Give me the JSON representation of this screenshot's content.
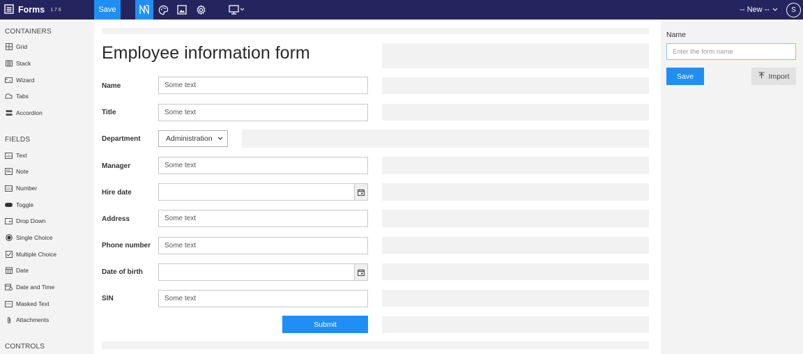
{
  "app": {
    "name": "Forms",
    "version": "1.7.6"
  },
  "toolbar": {
    "save_label": "Save",
    "new_label": "-- New --",
    "avatar_initial": "S"
  },
  "sidebar": {
    "containers_heading": "CONTAINERS",
    "containers": [
      {
        "label": "Grid",
        "icon": "grid-icon"
      },
      {
        "label": "Stack",
        "icon": "stack-icon"
      },
      {
        "label": "Wizard",
        "icon": "wizard-icon"
      },
      {
        "label": "Tabs",
        "icon": "tabs-icon"
      },
      {
        "label": "Accordion",
        "icon": "accordion-icon"
      }
    ],
    "fields_heading": "FIELDS",
    "fields": [
      {
        "label": "Text",
        "icon": "text-field-icon"
      },
      {
        "label": "Note",
        "icon": "note-icon"
      },
      {
        "label": "Number",
        "icon": "number-icon"
      },
      {
        "label": "Toggle",
        "icon": "toggle-icon"
      },
      {
        "label": "Drop Down",
        "icon": "dropdown-icon"
      },
      {
        "label": "Single Choice",
        "icon": "radio-icon"
      },
      {
        "label": "Multiple Choice",
        "icon": "checkbox-icon"
      },
      {
        "label": "Date",
        "icon": "calendar-icon"
      },
      {
        "label": "Date and Time",
        "icon": "datetime-icon"
      },
      {
        "label": "Masked Text",
        "icon": "masked-text-icon"
      },
      {
        "label": "Attachments",
        "icon": "paperclip-icon"
      }
    ],
    "controls_heading": "CONTROLS"
  },
  "form": {
    "title": "Employee information form",
    "fields": [
      {
        "label": "Name",
        "placeholder": "Some text"
      },
      {
        "label": "Title",
        "placeholder": "Some text"
      },
      {
        "label": "Department",
        "value": "Administration"
      },
      {
        "label": "Manager",
        "placeholder": "Some text"
      },
      {
        "label": "Hire date",
        "placeholder": ""
      },
      {
        "label": "Address",
        "placeholder": "Some text"
      },
      {
        "label": "Phone number",
        "placeholder": "Some text"
      },
      {
        "label": "Date of birth",
        "placeholder": ""
      },
      {
        "label": "SIN",
        "placeholder": "Some text"
      }
    ],
    "submit_label": "Submit"
  },
  "right_panel": {
    "name_label": "Name",
    "name_placeholder": "Enter the form name",
    "save_label": "Save",
    "import_label": "Import"
  },
  "colors": {
    "topbar": "#24245e",
    "accent": "#1f8ff5",
    "panel_bg": "#f3f3f3",
    "placeholder_block": "#f2f2f2"
  }
}
